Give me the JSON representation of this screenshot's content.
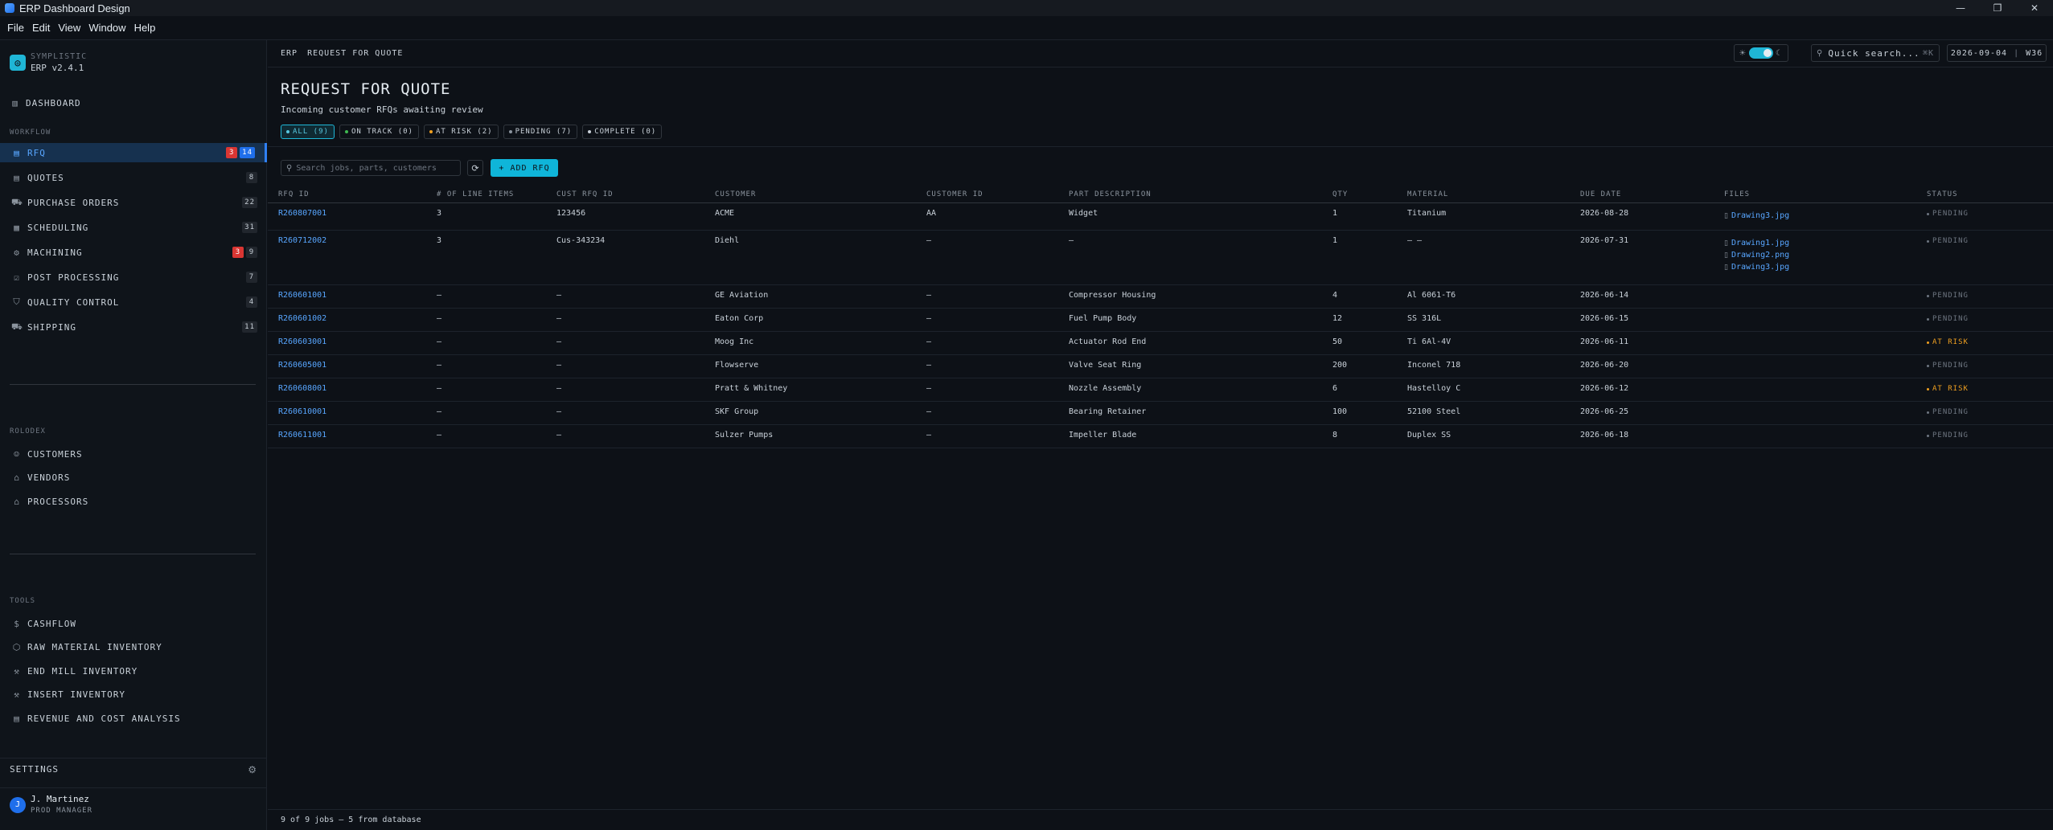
{
  "window": {
    "title": "ERP Dashboard Design",
    "controls": [
      "—",
      "❐",
      "✕"
    ]
  },
  "menu": [
    "File",
    "Edit",
    "View",
    "Window",
    "Help"
  ],
  "sidebar": {
    "brand_name": "SYMPLISTIC",
    "brand_version": "ERP v2.4.1",
    "dashboard": "DASHBOARD",
    "workflow_label": "WORKFLOW",
    "workflow": [
      {
        "label": "RFQ",
        "icon": "document-icon",
        "glyph": "▤",
        "badges": [
          {
            "value": "3",
            "kind": "red"
          },
          {
            "value": "14",
            "kind": "blue"
          }
        ],
        "active": true
      },
      {
        "label": "QUOTES",
        "icon": "quote-icon",
        "glyph": "▤",
        "badges": [
          {
            "value": "8",
            "kind": "plain"
          }
        ]
      },
      {
        "label": "PURCHASE ORDERS",
        "icon": "cart-icon",
        "glyph": "⛟",
        "badges": [
          {
            "value": "22",
            "kind": "plain"
          }
        ]
      },
      {
        "label": "SCHEDULING",
        "icon": "calendar-icon",
        "glyph": "▦",
        "badges": [
          {
            "value": "31",
            "kind": "plain"
          }
        ]
      },
      {
        "label": "MACHINING",
        "icon": "cog-icon",
        "glyph": "⚙",
        "badges": [
          {
            "value": "3",
            "kind": "red"
          },
          {
            "value": "9",
            "kind": "plain"
          }
        ]
      },
      {
        "label": "POST PROCESSING",
        "icon": "check-square-icon",
        "glyph": "☑",
        "badges": [
          {
            "value": "7",
            "kind": "plain"
          }
        ]
      },
      {
        "label": "QUALITY CONTROL",
        "icon": "shield-icon",
        "glyph": "⛉",
        "badges": [
          {
            "value": "4",
            "kind": "plain"
          }
        ]
      },
      {
        "label": "SHIPPING",
        "icon": "truck-icon",
        "glyph": "⛟",
        "badges": [
          {
            "value": "11",
            "kind": "plain"
          }
        ]
      }
    ],
    "rolodex_label": "ROLODEX",
    "rolodex": [
      {
        "label": "CUSTOMERS",
        "icon": "users-icon",
        "glyph": "☺"
      },
      {
        "label": "VENDORS",
        "icon": "store-icon",
        "glyph": "⌂"
      },
      {
        "label": "PROCESSORS",
        "icon": "factory-icon",
        "glyph": "⌂"
      }
    ],
    "tools_label": "TOOLS",
    "tools": [
      {
        "label": "CASHFLOW",
        "icon": "dollar-icon",
        "glyph": "$"
      },
      {
        "label": "RAW MATERIAL INVENTORY",
        "icon": "box-icon",
        "glyph": "⬡"
      },
      {
        "label": "END MILL INVENTORY",
        "icon": "wrench-icon",
        "glyph": "⚒"
      },
      {
        "label": "INSERT INVENTORY",
        "icon": "wrench-icon",
        "glyph": "⚒"
      },
      {
        "label": "REVENUE AND COST ANALYSIS",
        "icon": "chart-icon",
        "glyph": "▤"
      }
    ],
    "settings": "SETTINGS",
    "user": {
      "initial": "J",
      "name": "J. Martinez",
      "role": "PROD MANAGER"
    }
  },
  "topbar": {
    "crumb_root": "ERP",
    "crumb_page": "REQUEST FOR QUOTE",
    "quick_search": "Quick search...",
    "shortcut": "⌘K",
    "date": "2026-09-04",
    "week": "W36"
  },
  "page": {
    "title": "REQUEST FOR QUOTE",
    "subtitle": "Incoming customer RFQs awaiting review",
    "filters": [
      {
        "label": "ALL (9)",
        "color": "#58c8e0",
        "active": true
      },
      {
        "label": "ON TRACK (0)",
        "color": "#3fb950"
      },
      {
        "label": "AT RISK (2)",
        "color": "#f0a020"
      },
      {
        "label": "PENDING (7)",
        "color": "#8b949e"
      },
      {
        "label": "COMPLETE (0)",
        "color": "#c9d1d9"
      }
    ],
    "search_placeholder": "Search jobs, parts, customers",
    "add_label": "+ ADD RFQ",
    "footer": "9 of 9 jobs — 5 from database"
  },
  "table": {
    "columns": [
      "RFQ ID",
      "# OF LINE ITEMS",
      "CUST RFQ ID",
      "CUSTOMER",
      "CUSTOMER ID",
      "PART DESCRIPTION",
      "QTY",
      "MATERIAL",
      "DUE DATE",
      "FILES",
      "STATUS"
    ],
    "rows": [
      {
        "id": "R260807001",
        "lines": "3",
        "cust_rfq": "123456",
        "customer": "ACME",
        "cust_id": "AA",
        "part": "Widget",
        "qty": "1",
        "material": "Titanium",
        "due": "2026-08-28",
        "files": [
          "Drawing3.jpg"
        ],
        "status": "PENDING",
        "status_kind": "pending"
      },
      {
        "id": "R260712002",
        "lines": "3",
        "cust_rfq": "Cus-343234",
        "customer": "Diehl",
        "cust_id": "—",
        "part": "—",
        "qty": "1",
        "material": "— —",
        "due": "2026-07-31",
        "files": [
          "Drawing1.jpg",
          "Drawing2.png",
          "Drawing3.jpg"
        ],
        "status": "PENDING",
        "status_kind": "pending"
      },
      {
        "id": "R260601001",
        "lines": "—",
        "cust_rfq": "—",
        "customer": "GE Aviation",
        "cust_id": "—",
        "part": "Compressor Housing",
        "qty": "4",
        "material": "Al 6061-T6",
        "due": "2026-06-14",
        "files": [],
        "status": "PENDING",
        "status_kind": "pending"
      },
      {
        "id": "R260601002",
        "lines": "—",
        "cust_rfq": "—",
        "customer": "Eaton Corp",
        "cust_id": "—",
        "part": "Fuel Pump Body",
        "qty": "12",
        "material": "SS 316L",
        "due": "2026-06-15",
        "files": [],
        "status": "PENDING",
        "status_kind": "pending"
      },
      {
        "id": "R260603001",
        "lines": "—",
        "cust_rfq": "—",
        "customer": "Moog Inc",
        "cust_id": "—",
        "part": "Actuator Rod End",
        "qty": "50",
        "material": "Ti 6Al-4V",
        "due": "2026-06-11",
        "files": [],
        "status": "AT RISK",
        "status_kind": "risk"
      },
      {
        "id": "R260605001",
        "lines": "—",
        "cust_rfq": "—",
        "customer": "Flowserve",
        "cust_id": "—",
        "part": "Valve Seat Ring",
        "qty": "200",
        "material": "Inconel 718",
        "due": "2026-06-20",
        "files": [],
        "status": "PENDING",
        "status_kind": "pending"
      },
      {
        "id": "R260608001",
        "lines": "—",
        "cust_rfq": "—",
        "customer": "Pratt & Whitney",
        "cust_id": "—",
        "part": "Nozzle Assembly",
        "qty": "6",
        "material": "Hastelloy C",
        "due": "2026-06-12",
        "files": [],
        "status": "AT RISK",
        "status_kind": "risk"
      },
      {
        "id": "R260610001",
        "lines": "—",
        "cust_rfq": "—",
        "customer": "SKF Group",
        "cust_id": "—",
        "part": "Bearing Retainer",
        "qty": "100",
        "material": "52100 Steel",
        "due": "2026-06-25",
        "files": [],
        "status": "PENDING",
        "status_kind": "pending"
      },
      {
        "id": "R260611001",
        "lines": "—",
        "cust_rfq": "—",
        "customer": "Sulzer Pumps",
        "cust_id": "—",
        "part": "Impeller Blade",
        "qty": "8",
        "material": "Duplex SS",
        "due": "2026-06-18",
        "files": [],
        "status": "PENDING",
        "status_kind": "pending"
      }
    ]
  }
}
